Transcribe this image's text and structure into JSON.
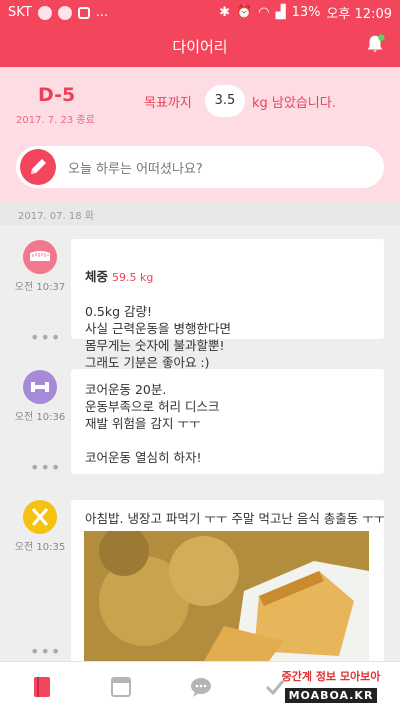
{
  "status": {
    "carrier": "SKT",
    "battery": "13%",
    "time": "오후 12:09",
    "more": "..."
  },
  "appbar": {
    "title": "다이어리"
  },
  "goal": {
    "dday": "D-5",
    "end_date": "2017. 7. 23 종료",
    "prefix": "목표까지",
    "remaining": "3.5",
    "suffix": "kg 남았습니다."
  },
  "write": {
    "placeholder": "오늘 하루는 어떠셨나요?"
  },
  "date_header": "2017. 07. 18 화",
  "entries": [
    {
      "icon": "scale-icon",
      "color": "#f2788d",
      "time": "오전 10:37",
      "weight_label": "체중",
      "weight_value": "59.5 kg",
      "text": "0.5kg 감량!\n사실 근력운동을 병행한다면\n몸무게는 숫자에 불과할뿐!\n그래도 기분은 좋아요 :)"
    },
    {
      "icon": "dumbbell-icon",
      "color": "#a58ad8",
      "time": "오전 10:36",
      "text": "코어운동 20분.\n운동부족으로 허리 디스크\n재발 위험을 감지 ㅜㅜ\n\n코어운동 열심히 하자!"
    },
    {
      "icon": "fork-knife-icon",
      "color": "#f4c211",
      "time": "오전 10:35",
      "text": "아침밥. 냉장고 파먹기 ㅜㅜ 주말 먹고난 음식 총출동 ㅜㅜ"
    }
  ],
  "dots": "•••",
  "watermark": {
    "top": "중간계 정보 모아보아",
    "bottom": "MOABOA.KR"
  },
  "colors": {
    "primary": "#f3455c",
    "pink_bg": "#fddde3"
  }
}
